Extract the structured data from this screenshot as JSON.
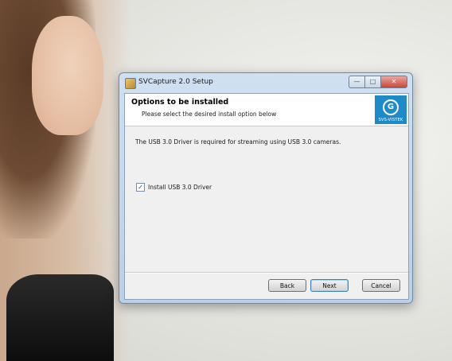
{
  "window": {
    "title": "SVCapture 2.0 Setup",
    "controls": {
      "minimize": "—",
      "maximize": "□",
      "close": "✕"
    }
  },
  "banner": {
    "title": "Options to be installed",
    "subtitle": "Please select the desired install option below",
    "logo_text": "SVS-VISTEK",
    "logo_mark": "G"
  },
  "content": {
    "info": "The USB 3.0 Driver is required for streaming using USB 3.0 cameras.",
    "option": {
      "label": "Install USB 3.0 Driver",
      "checked": true,
      "check_glyph": "✓"
    }
  },
  "buttons": {
    "back": "Back",
    "next": "Next",
    "cancel": "Cancel"
  },
  "colors": {
    "logo_bg": "#1d8ac9",
    "window_frame": "#b9d0e8",
    "close_button": "#c9463a"
  }
}
